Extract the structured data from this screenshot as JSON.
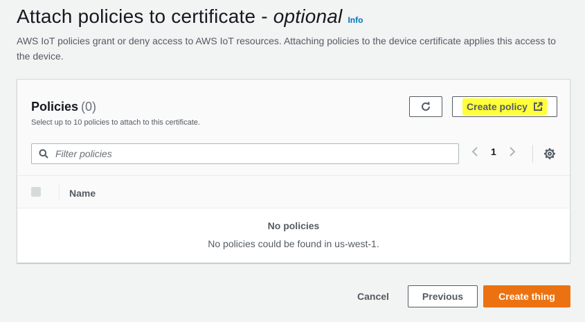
{
  "header": {
    "title": "Attach policies to certificate - ",
    "title_optional": "optional",
    "info_link": "Info",
    "description": "AWS IoT policies grant or deny access to AWS IoT resources. Attaching policies to the device certificate applies this access to the device."
  },
  "policies": {
    "heading": "Policies",
    "count": "(0)",
    "subtext": "Select up to 10 policies to attach to this certificate.",
    "refresh_icon": "refresh-icon",
    "create_policy_label": "Create policy",
    "create_policy_icon": "external-link-icon",
    "filter_placeholder": "Filter policies",
    "page_number": "1",
    "table": {
      "columns": [
        "Name"
      ]
    },
    "empty_title": "No policies",
    "empty_message": "No policies could be found in us-west-1."
  },
  "footer": {
    "cancel_label": "Cancel",
    "previous_label": "Previous",
    "create_thing_label": "Create thing"
  },
  "colors": {
    "primary_button": "#ec7211",
    "highlight": "#ffff3a",
    "link": "#0073bb"
  }
}
